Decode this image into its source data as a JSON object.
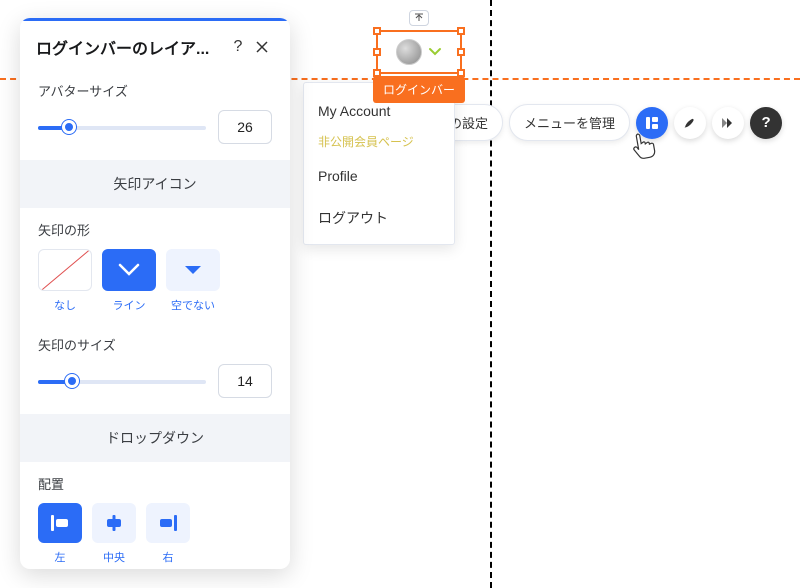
{
  "panel": {
    "title": "ログインバーのレイア...",
    "help_tooltip": "?",
    "avatar_size_label": "アバターサイズ",
    "avatar_size_value": "26",
    "band_arrow": "矢印アイコン",
    "arrow_shape_label": "矢印の形",
    "arrow_shapes": {
      "none": "なし",
      "line": "ライン",
      "fill": "空でない"
    },
    "arrow_size_label": "矢印のサイズ",
    "arrow_size_value": "14",
    "band_dropdown": "ドロップダウン",
    "align_label": "配置",
    "align_options": {
      "left": "左",
      "center": "中央",
      "right": "右"
    }
  },
  "element": {
    "tooltip": "ログインバー"
  },
  "dropdown": {
    "item1": "My Account",
    "private": "非公開会員ページ",
    "item2": "Profile",
    "item3": "ログアウト"
  },
  "toolbar": {
    "settings_label": "ログインバーの設定",
    "manage_label": "メニューを管理"
  }
}
